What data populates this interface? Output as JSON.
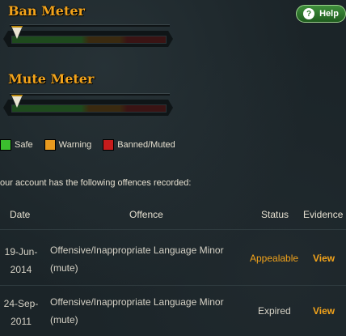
{
  "ban_meter": {
    "title": "Ban Meter",
    "level": 0
  },
  "mute_meter": {
    "title": "Mute Meter",
    "level": 0
  },
  "help": {
    "label": "Help",
    "icon": "question-icon"
  },
  "legend": [
    {
      "label": "Safe",
      "color": "#3bbf2e"
    },
    {
      "label": "Warning",
      "color": "#e89a1f"
    },
    {
      "label": "Banned/Muted",
      "color": "#c61c1c"
    }
  ],
  "intro": "our account has the following offences recorded:",
  "table": {
    "headers": [
      "Date",
      "Offence",
      "Status",
      "Evidence"
    ],
    "rows": [
      {
        "date_line1": "19-Jun-",
        "date_line2": "2014",
        "offence_line1": "Offensive/Inappropriate Language Minor",
        "offence_line2": "(mute)",
        "status": "Appealable",
        "evidence": "View"
      },
      {
        "date_line1": "24-Sep-",
        "date_line2": "2011",
        "offence_line1": "Offensive/Inappropriate Language Minor",
        "offence_line2": "(mute)",
        "status": "Expired",
        "evidence": "View"
      }
    ]
  }
}
